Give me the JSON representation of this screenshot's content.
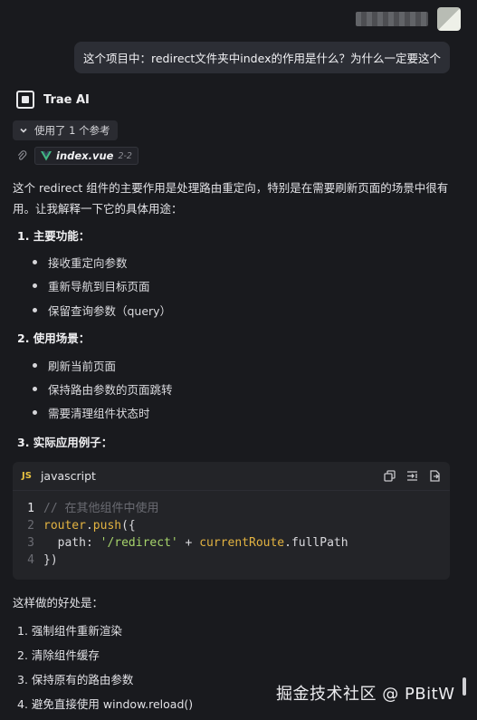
{
  "user": {
    "bubble_text": "这个项目中：redirect文件夹中index的作用是什么？为什么一定要这个"
  },
  "ai": {
    "name": "Trae AI",
    "ref_toggle_label": "使用了 1 个参考",
    "file_name": "index.vue",
    "file_range": "2-2"
  },
  "intro": "这个 redirect 组件的主要作用是处理路由重定向，特别是在需要刷新页面的场景中很有用。让我解释一下它的具体用途：",
  "sections": [
    {
      "heading": "1. 主要功能：",
      "bullets": [
        "接收重定向参数",
        "重新导航到目标页面",
        "保留查询参数（query）"
      ]
    },
    {
      "heading": "2. 使用场景：",
      "bullets": [
        "刷新当前页面",
        "保持路由参数的页面跳转",
        "需要清理组件状态时"
      ]
    },
    {
      "heading": "3. 实际应用例子：",
      "bullets": []
    }
  ],
  "code": {
    "badge": "JS",
    "language": "javascript",
    "line_numbers": [
      "1",
      "2",
      "3",
      "4"
    ],
    "lines": {
      "l1_comment": "// 在其他组件中使用",
      "l2_obj": "router",
      "l2_dot": ".",
      "l2_fn": "push",
      "l2_rest": "({",
      "l3_key": "  path: ",
      "l3_str": "'/redirect'",
      "l3_op": " + ",
      "l3_obj": "currentRoute",
      "l3_rest": ".fullPath",
      "l4": "})"
    }
  },
  "summary": "这样做的好处是：",
  "benefits": [
    "1. 强制组件重新渲染",
    "2. 清除组件缓存",
    "3. 保持原有的路由参数",
    "4. 避免直接使用 window.reload()"
  ],
  "watermark": "掘金技术社区 @ PBitW",
  "icons": {
    "ai_logo": "trae-logo-icon",
    "toggle": "chevron-down-icon",
    "attachment": "paperclip-icon",
    "vue": "vue-icon",
    "copy": "copy-icon",
    "insert": "insert-icon",
    "apply": "apply-icon"
  },
  "colors": {
    "background": "#191a1e",
    "vue_green": "#42b883",
    "js_yellow": "#e9c341",
    "string_green": "#a6d36b",
    "function_gold": "#e3b341"
  }
}
